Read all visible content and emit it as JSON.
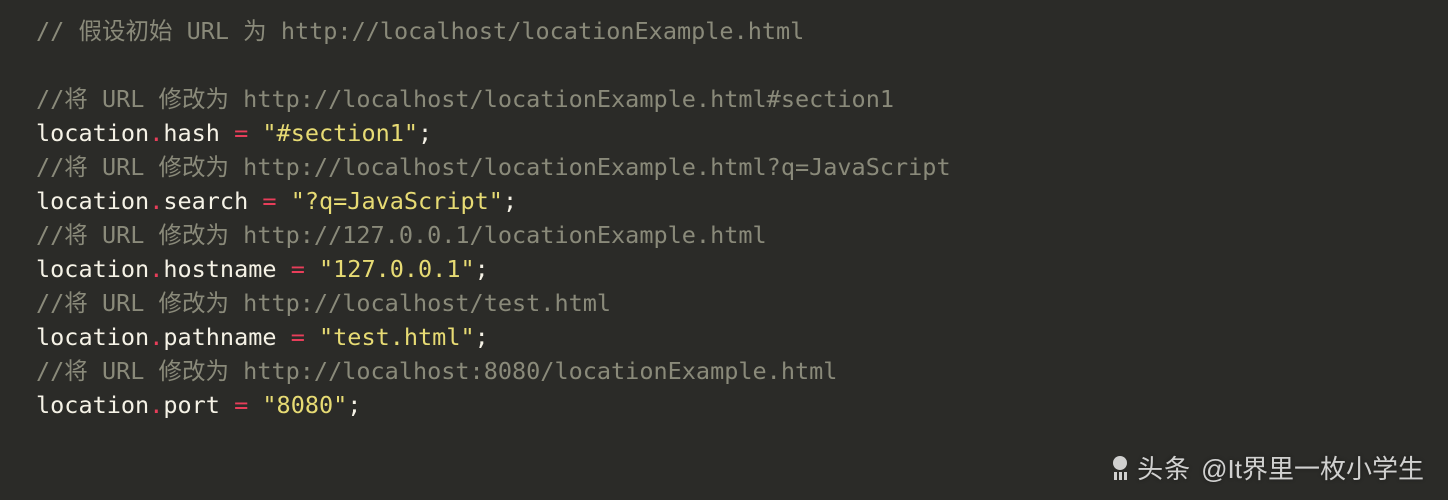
{
  "code": {
    "lines": [
      {
        "type": "comment",
        "text": "// 假设初始 URL 为 http://localhost/locationExample.html"
      },
      {
        "type": "blank"
      },
      {
        "type": "comment",
        "text": "//将 URL 修改为 http://localhost/locationExample.html#section1"
      },
      {
        "type": "assign",
        "object": "location",
        "property": "hash",
        "value": "\"#section1\""
      },
      {
        "type": "comment",
        "text": "//将 URL 修改为 http://localhost/locationExample.html?q=JavaScript"
      },
      {
        "type": "assign",
        "object": "location",
        "property": "search",
        "value": "\"?q=JavaScript\""
      },
      {
        "type": "comment",
        "text": "//将 URL 修改为 http://127.0.0.1/locationExample.html"
      },
      {
        "type": "assign",
        "object": "location",
        "property": "hostname",
        "value": "\"127.0.0.1\""
      },
      {
        "type": "comment",
        "text": "//将 URL 修改为 http://localhost/test.html"
      },
      {
        "type": "assign",
        "object": "location",
        "property": "pathname",
        "value": "\"test.html\""
      },
      {
        "type": "comment",
        "text": "//将 URL 修改为 http://localhost:8080/locationExample.html"
      },
      {
        "type": "assign",
        "object": "location",
        "property": "port",
        "value": "\"8080\""
      }
    ]
  },
  "watermark": {
    "brand": "头条",
    "handle": "@It界里一枚小学生"
  }
}
